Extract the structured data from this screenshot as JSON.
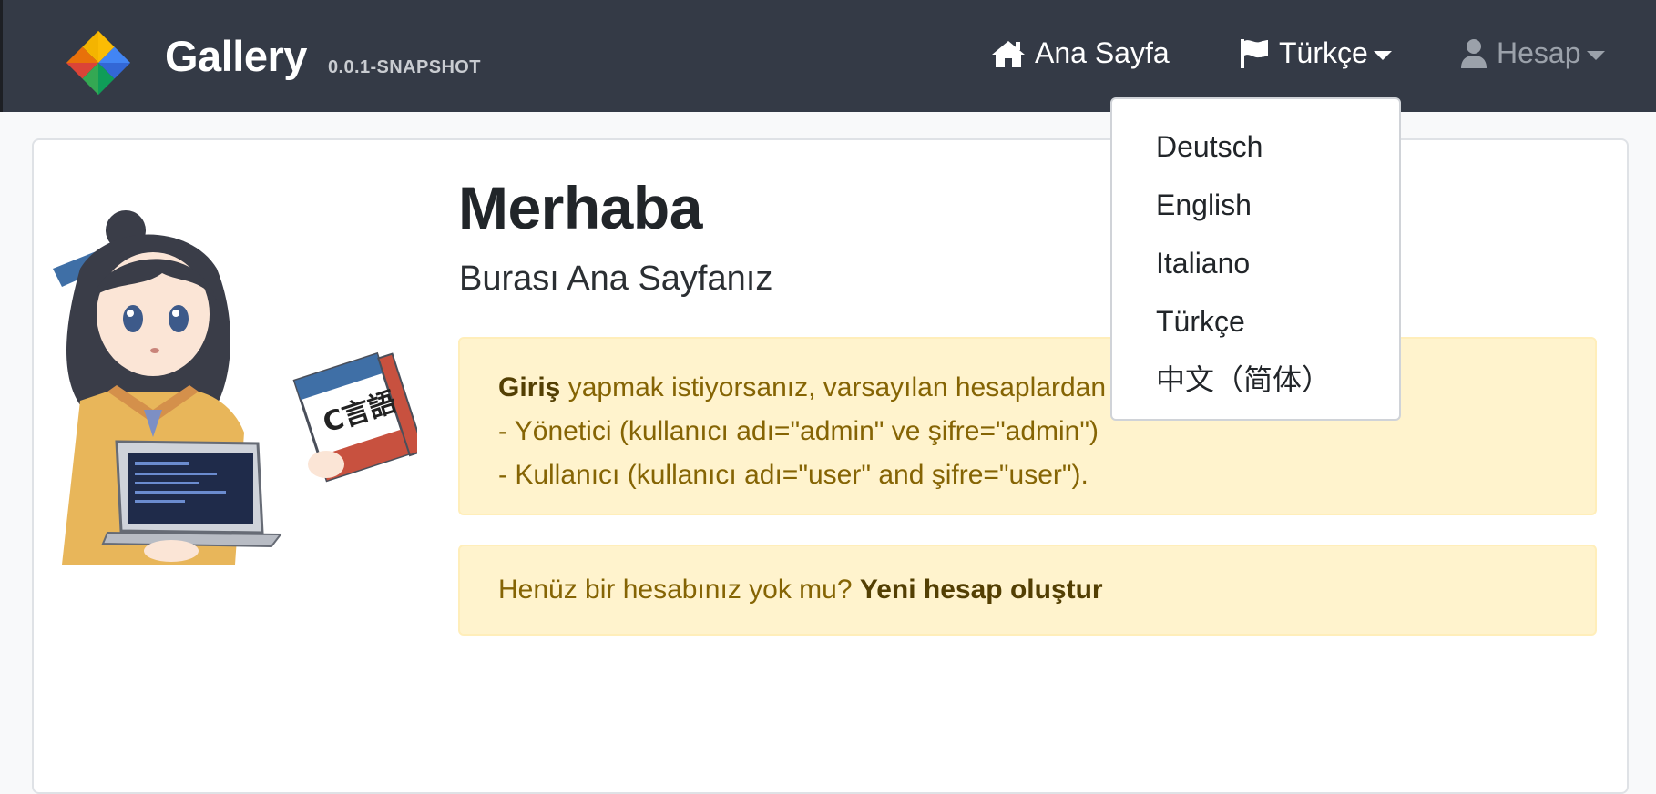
{
  "navbar": {
    "brand_name": "Gallery",
    "brand_version": "0.0.1-SNAPSHOT",
    "home_label": "Ana Sayfa",
    "home_icon": "home-icon",
    "language_label": "Türkçe",
    "language_icon": "flag-icon",
    "account_label": "Hesap",
    "account_icon": "user-icon"
  },
  "language_menu": {
    "items": [
      "Deutsch",
      "English",
      "Italiano",
      "Türkçe",
      "中文（简体）"
    ]
  },
  "main": {
    "title": "Merhaba",
    "subtitle": "Burası Ana Sayfanız",
    "login_alert": {
      "bold": "Giriş",
      "text": " yapmak istiyorsanız, varsayılan hesaplardan birini kullanabiliniz:",
      "line2": "- Yönetici (kullanıcı adı=\"admin\" ve şifre=\"admin\")",
      "line3": "- Kullanıcı (kullanıcı adı=\"user\" and şifre=\"user\")."
    },
    "register_alert": {
      "text": "Henüz bir hesabınız yok mu? ",
      "link": "Yeni hesap oluştur"
    },
    "mascot_book_text": "C言語"
  },
  "colors": {
    "navbar_bg": "#343a46",
    "alert_bg": "#fff3cd",
    "alert_text": "#856404"
  }
}
